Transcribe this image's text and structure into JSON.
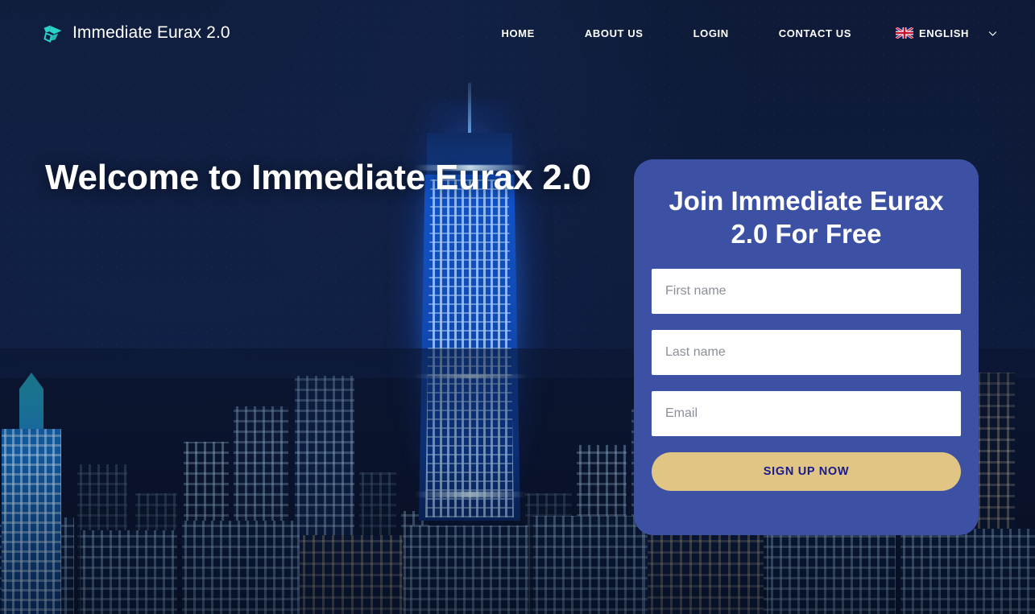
{
  "brand": {
    "name": "Immediate Eurax 2.0",
    "logo_icon": "arrow-logo-icon",
    "logo_color": "#2ad2c9"
  },
  "nav": {
    "items": [
      {
        "label": "HOME"
      },
      {
        "label": "ABOUT US"
      },
      {
        "label": "LOGIN"
      },
      {
        "label": "CONTACT US"
      }
    ],
    "language": {
      "label": "ENGLISH",
      "flag_icon": "uk-flag-icon",
      "chevron_icon": "chevron-down-icon"
    }
  },
  "hero": {
    "title": "Welcome to Immediate Eurax 2.0"
  },
  "signup": {
    "title": "Join Immediate Eurax 2.0 For Free",
    "first_name": {
      "placeholder": "First name",
      "value": ""
    },
    "last_name": {
      "placeholder": "Last name",
      "value": ""
    },
    "email": {
      "placeholder": "Email",
      "value": ""
    },
    "submit_label": "SIGN UP NOW"
  },
  "colors": {
    "card_bg": "#3c50a4",
    "button_bg": "#e0c584",
    "button_text": "#181a8e",
    "page_bg": "#0b1530",
    "accent": "#2ad2c9"
  }
}
